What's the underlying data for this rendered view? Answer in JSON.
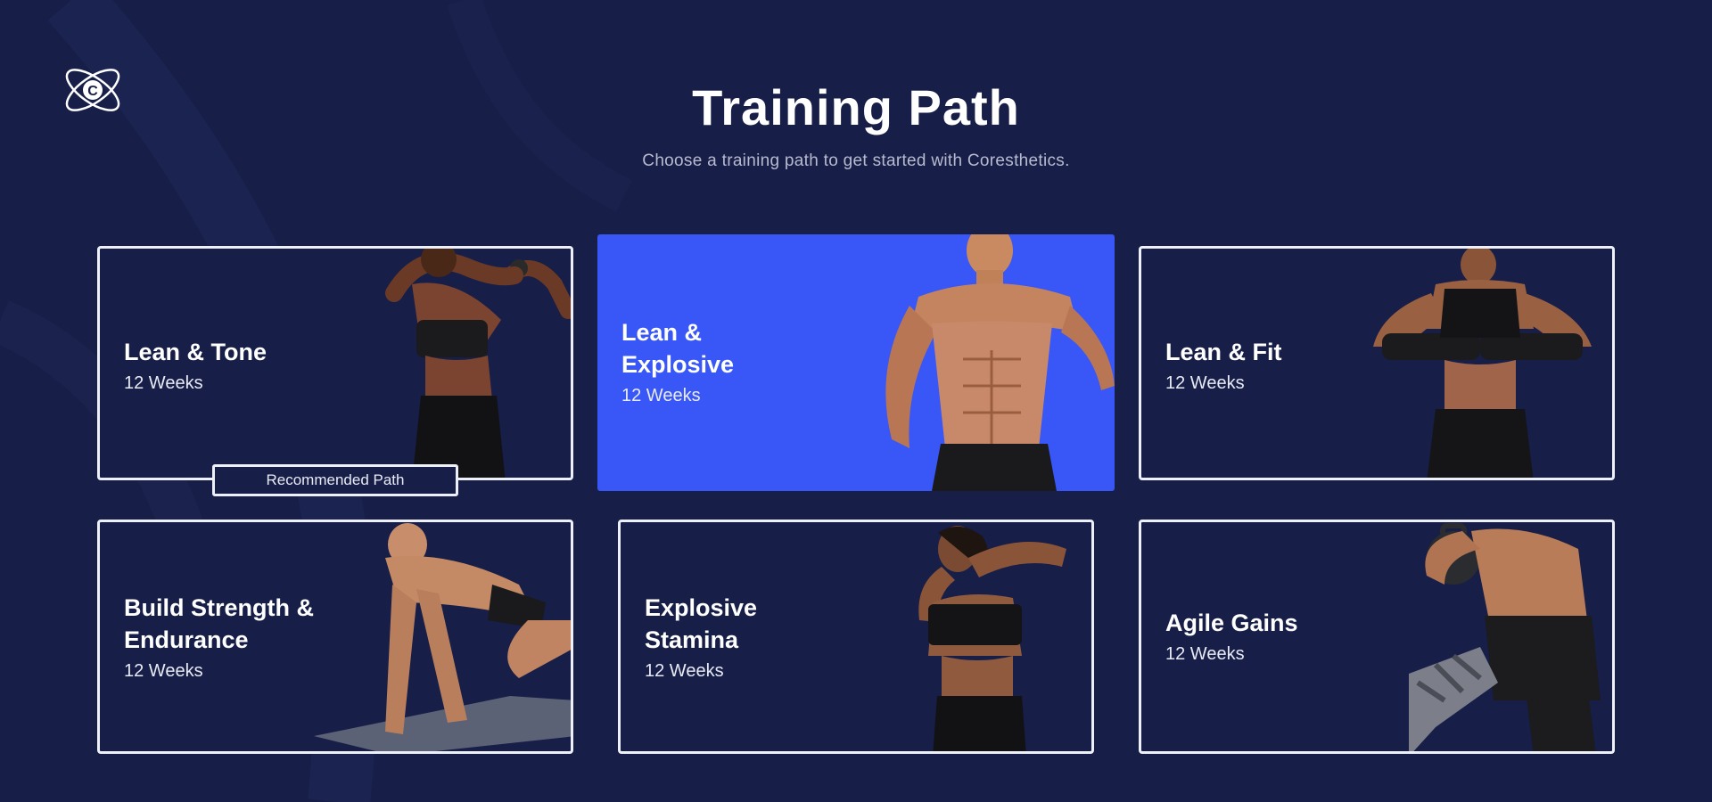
{
  "header": {
    "title": "Training Path",
    "subtitle": "Choose a training path to get started with Coresthetics."
  },
  "logo": {
    "icon": "atom-c-logo-icon",
    "letter": "C"
  },
  "paths": [
    {
      "id": "lean-tone",
      "title": "Lean & Tone",
      "duration": "12 Weeks",
      "selected": false,
      "badge": "Recommended Path",
      "image": "athletic-woman-photo"
    },
    {
      "id": "lean-explosive",
      "title": "Lean & Explosive",
      "duration": "12 Weeks",
      "selected": true,
      "image": "muscular-man-photo"
    },
    {
      "id": "lean-fit",
      "title": "Lean & Fit",
      "duration": "12 Weeks",
      "selected": false,
      "image": "boxing-woman-photo"
    },
    {
      "id": "strength-endurance",
      "title": "Build Strength & Endurance",
      "duration": "12 Weeks",
      "selected": false,
      "image": "man-on-mat-photo"
    },
    {
      "id": "explosive-stamina",
      "title": "Explosive Stamina",
      "duration": "12 Weeks",
      "selected": false,
      "image": "stretching-woman-photo"
    },
    {
      "id": "agile-gains",
      "title": "Agile Gains",
      "duration": "12 Weeks",
      "selected": false,
      "image": "kettlebell-man-photo"
    }
  ],
  "colors": {
    "background": "#171e47",
    "selected_card": "#3857f6",
    "card_border": "#eef0f7",
    "subtitle_text": "#b7bbd0"
  }
}
